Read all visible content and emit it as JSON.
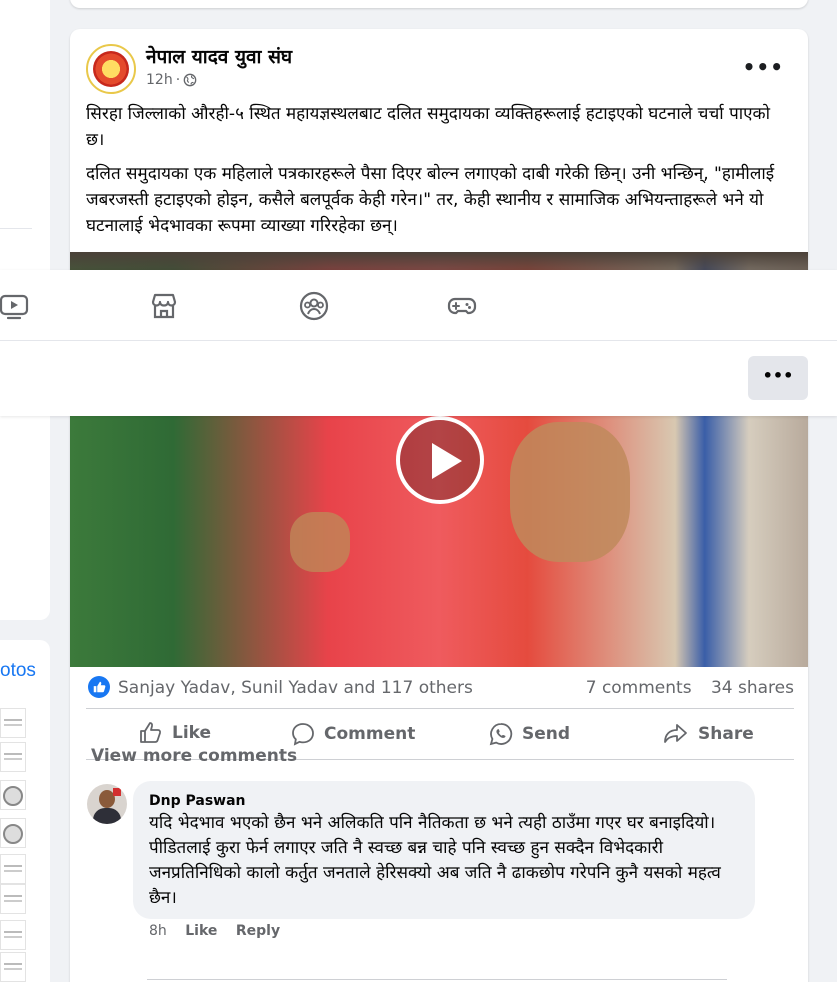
{
  "left": {
    "photos_label": "otos"
  },
  "post": {
    "page_name": "नेपाल यादव युवा संघ",
    "time": "12h",
    "dot": "·",
    "more": "•••",
    "paragraphs": [
      "सिरहा जिल्लाको औरही-५ स्थित महायज्ञस्थलबाट दलित समुदायका व्यक्तिहरूलाई हटाइएको घटनाले चर्चा पाएको छ।",
      "दलित समुदायका एक महिलाले पत्रकारहरूले पैसा दिएर बोल्न लगाएको दाबी गरेकी छिन्। उनी भन्छिन्, \"हामीलाई जबरजस्ती हटाइएको होइन, कसैले बलपूर्वक केही गरेन।\" तर, केही स्थानीय र सामाजिक अभियन्ताहरूले भने यो घटनालाई भेदभावका रूपमा व्याख्या गरिरहेका छन्।"
    ],
    "reactors": "Sanjay Yadav, Sunil Yadav and 117 others",
    "comments_count": "7 comments",
    "shares_count": "34 shares",
    "actions": {
      "like": "Like",
      "comment": "Comment",
      "send": "Send",
      "share": "Share"
    },
    "view_more_comments": "View more comments"
  },
  "overlay": {
    "more": "•••",
    "icons": [
      "video-icon",
      "marketplace-icon",
      "groups-icon",
      "gaming-icon"
    ]
  },
  "comment": {
    "author": "Dnp Paswan",
    "text": "यदि भेदभाव भएको छैन भने अलिकति पनि नैतिकता छ भने त्यही ठाउँमा गएर घर बनाइदियो। पीडितलाई कुरा फेर्न लगाएर जति नै स्वच्छ बन्न चाहे पनि स्वच्छ हुन सक्दैन विभेदकारी जनप्रतिनिधिको कालो कर्तुत जनताले हेरिसक्यो अब जति नै ढाकछोप गरेपनि कुनै यसको महत्व छैन।",
    "time": "8h",
    "like": "Like",
    "reply": "Reply"
  },
  "colors": {
    "brand": "#1877f2",
    "secondary_text": "#65676b",
    "background": "#f0f2f5"
  }
}
